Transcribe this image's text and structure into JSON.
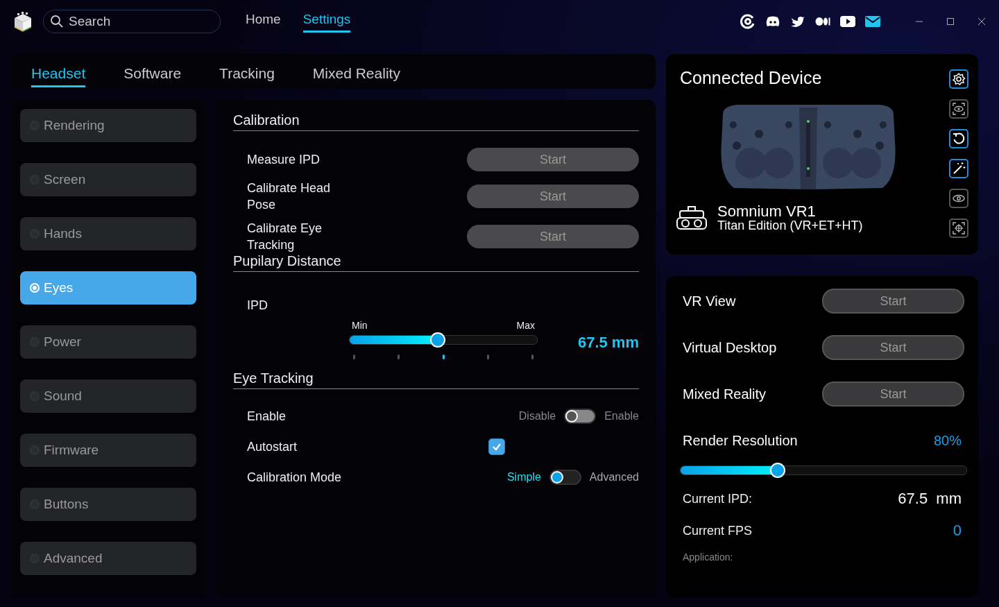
{
  "nav": {
    "search": {
      "placeholder": "Search"
    },
    "links": [
      {
        "label": "Home",
        "selected": false
      },
      {
        "label": "Settings",
        "selected": true
      }
    ],
    "social": [
      {
        "kind": "at"
      },
      {
        "kind": "chat"
      },
      {
        "kind": "bird"
      },
      {
        "kind": "dots"
      },
      {
        "kind": "play"
      },
      {
        "kind": "mail"
      }
    ]
  },
  "tabs": [
    {
      "label": "Headset",
      "selected": true
    },
    {
      "label": "Software",
      "selected": false
    },
    {
      "label": "Tracking",
      "selected": false
    },
    {
      "label": "Mixed Reality",
      "selected": false
    }
  ],
  "sidebar": {
    "items": [
      {
        "label": "Rendering",
        "selected": false
      },
      {
        "label": "Screen",
        "selected": false
      },
      {
        "label": "Hands",
        "selected": false
      },
      {
        "label": "Eyes",
        "selected": true
      },
      {
        "label": "Power",
        "selected": false
      },
      {
        "label": "Sound",
        "selected": false
      },
      {
        "label": "Firmware",
        "selected": false
      },
      {
        "label": "Buttons",
        "selected": false
      },
      {
        "label": "Advanced",
        "selected": false
      }
    ]
  },
  "calibration": {
    "title": "Calibration",
    "rows": [
      {
        "label": "Measure IPD",
        "button": "Start"
      },
      {
        "label": "Calibrate Head Pose",
        "button": "Start"
      },
      {
        "label": "Calibrate Eye Tracking",
        "button": "Start"
      }
    ]
  },
  "pupillary": {
    "title": "Pupilary Distance",
    "label": "IPD",
    "min": "Min",
    "max": "Max",
    "level": 0.47,
    "value": "67.5 mm",
    "ticks": [
      {
        "selected": false
      },
      {
        "selected": false
      },
      {
        "selected": true
      },
      {
        "selected": false
      },
      {
        "selected": false
      }
    ]
  },
  "eye_tracking": {
    "title": "Eye Tracking",
    "rows": [
      {
        "kind": "toggle",
        "label": "Enable",
        "off_label": "Disable",
        "on_label": "Enable",
        "on": false
      },
      {
        "kind": "checkbox",
        "label": "Autostart",
        "checked": true
      },
      {
        "kind": "mode",
        "label": "Calibration Mode",
        "off_label": "Simple",
        "on_label": "Advanced",
        "on": false
      }
    ]
  },
  "device": {
    "title": "Connected Device",
    "name": "Somnium VR1",
    "edition": "Titan Edition (VR+ET+HT)",
    "tools": [
      {
        "kind": "gear",
        "active": true
      },
      {
        "kind": "eye-scan",
        "active": false
      },
      {
        "kind": "reset",
        "active": true
      },
      {
        "kind": "wand",
        "active": true
      },
      {
        "kind": "eye",
        "active": false
      },
      {
        "kind": "target",
        "active": false
      }
    ]
  },
  "launch": {
    "rows": [
      {
        "label": "VR View",
        "button": "Start"
      },
      {
        "label": "Virtual Desktop",
        "button": "Start"
      },
      {
        "label": "Mixed Reality",
        "button": "Start"
      }
    ],
    "render": {
      "label": "Render Resolution",
      "value": "80%",
      "level": 0.34
    },
    "ipd": {
      "label": "Current IPD:",
      "value": "67.5  mm"
    },
    "fps": {
      "label": "Current FPS",
      "value": "0"
    },
    "application": {
      "label": "Application:"
    }
  }
}
